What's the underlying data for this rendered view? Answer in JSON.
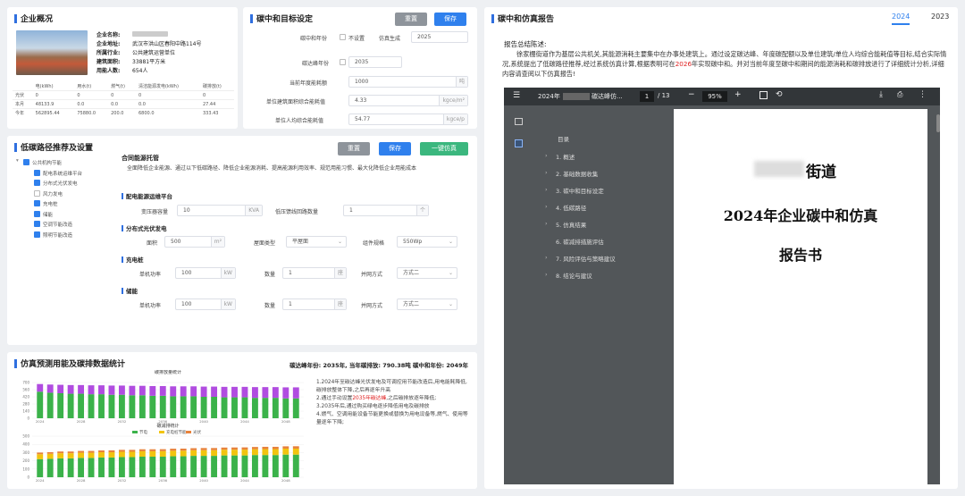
{
  "overview": {
    "title": "企业概况",
    "info": [
      {
        "label": "企业名称:",
        "value": ""
      },
      {
        "label": "企业地址:",
        "value": "武汉市洪山区春阳中路114号"
      },
      {
        "label": "所属行业:",
        "value": "公共建筑运营单位"
      },
      {
        "label": "建筑面积:",
        "value": "33881平方米"
      },
      {
        "label": "用能人数:",
        "value": "654人"
      }
    ],
    "table": {
      "headers": [
        "",
        "电(kWh)",
        "用水(t)",
        "燃气(t)",
        "清洁能源发电(kWh)",
        "碳排放(t)"
      ],
      "rows": [
        [
          "光伏",
          "0",
          "0",
          "0",
          "0",
          "0"
        ],
        [
          "本月",
          "48133.9",
          "0.0",
          "0.0",
          "0.0",
          "27.44"
        ],
        [
          "今年",
          "562895.44",
          "75880.0",
          "200.0",
          "6800.0",
          "333.43"
        ]
      ]
    }
  },
  "target": {
    "title": "碳中和目标设定",
    "reset": "重置",
    "save": "保存",
    "neutral_year_label": "碳中和年份",
    "not_set": "不设置",
    "simulate_label": "仿真生成",
    "neutral_year_value": "2025",
    "peak_year_label": "碳达峰年份",
    "peak_year_value": "2035",
    "total_label": "当前年度能耗额",
    "total_value": "1000",
    "total_unit": "吨",
    "area_label": "单位建筑面积综合能耗值",
    "area_value": "4.33",
    "area_unit": "kgce/m²",
    "person_label": "单位人均综合能耗值",
    "person_value": "54.77",
    "person_unit": "kgce/p"
  },
  "path": {
    "title": "低碳路径推荐及设置",
    "reset": "重置",
    "save": "保存",
    "simulate": "一键仿真",
    "tree": [
      "公共机构节能",
      "配电系统运维平台",
      "分布式光伏发电",
      "风力发电",
      "充电桩",
      "储能",
      "空调节能改造",
      "照明节能改造"
    ],
    "tree_checked": [
      true,
      true,
      true,
      false,
      true,
      true,
      true,
      true
    ],
    "intro_title": "合同能源托管",
    "intro_text": "全面降低企业能源、通过以下低碳路径、降低企业能源消耗、提高能源利用效率、规范用能习惯、最大化降低企业用能成本",
    "s1": "配电能源运维平台",
    "s1_cap_label": "变压器容量",
    "s1_cap_value": "10",
    "s1_cap_unit": "KVA",
    "s1_cnt_label": "低压馈线回路数量",
    "s1_cnt_value": "1",
    "s1_cnt_unit": "个",
    "s2": "分布式光伏发电",
    "s2_area_label": "面积",
    "s2_area_value": "500",
    "s2_area_unit": "m²",
    "s2_roof_label": "屋面类型",
    "s2_roof_value": "平屋面",
    "s2_spec_label": "组件规格",
    "s2_spec_value": "550Wp",
    "s3": "充电桩",
    "s3_power_label": "单机功率",
    "s3_power_value": "100",
    "s3_power_unit": "kW",
    "s3_cnt_label": "数量",
    "s3_cnt_value": "1",
    "s3_cnt_unit": "座",
    "s3_mode_label": "并网方式",
    "s3_mode_value": "方式二",
    "s4": "储能",
    "s4_power_label": "单机功率",
    "s4_power_value": "100",
    "s4_power_unit": "kW",
    "s4_cnt_label": "数量",
    "s4_cnt_value": "1",
    "s4_cnt_unit": "座",
    "s4_mode_label": "并网方式",
    "s4_mode_value": "方式二"
  },
  "sim": {
    "title": "仿真预测用能及碳排数据统计",
    "summary": "碳达峰年份: 2035年, 当年碳排放: 790.38吨  碳中和年份: 2049年",
    "chart1_title": "碳排放量统计",
    "chart2_title": "碳减排统计",
    "notes": [
      "1.2024年至碳达峰光伏发电及可调控用节能改造后,用电能耗降低,碳排放整体下降,之后再逐年升高",
      "2.通过手动设置2035年碳达峰,之后碳排放逐年降低;",
      "3.2035年后,通过购买绿电逐步降低用电及碳排放",
      "4.燃气、空调用能设备节能更换或替换为用电设备等,燃气、使用等量逐年下降;"
    ],
    "note_highlight": "2035年碳达峰"
  },
  "chart_data": [
    {
      "type": "bar",
      "title": "碳排放量统计",
      "categories": [
        "2024",
        "2025",
        "2026",
        "2027",
        "2028",
        "2029",
        "2030",
        "2031",
        "2032",
        "2033",
        "2034",
        "2035",
        "2036",
        "2037",
        "2038",
        "2039",
        "2040",
        "2041",
        "2042",
        "2043",
        "2044",
        "2045",
        "2046",
        "2047",
        "2048",
        "2049"
      ],
      "series": [
        {
          "name": "",
          "values": [
            520,
            500,
            490,
            480,
            480,
            470,
            470,
            460,
            460,
            450,
            450,
            440,
            440,
            430,
            430,
            430,
            420,
            420,
            410,
            410,
            410,
            400,
            400,
            400,
            390,
            390
          ],
          "color": "#3bb24a"
        },
        {
          "name": "",
          "values": [
            150,
            160,
            165,
            170,
            170,
            175,
            175,
            180,
            180,
            185,
            185,
            190,
            190,
            195,
            195,
            195,
            200,
            200,
            205,
            205,
            205,
            210,
            210,
            210,
            215,
            215
          ],
          "color": "#b04ce0"
        }
      ],
      "ylim": [
        0,
        700
      ]
    },
    {
      "type": "bar",
      "title": "碳减排统计",
      "legend": [
        "节电",
        "充电桩节能",
        "光伏"
      ],
      "categories": [
        "2024",
        "2025",
        "2026",
        "2027",
        "2028",
        "2029",
        "2030",
        "2031",
        "2032",
        "2033",
        "2034",
        "2035",
        "2036",
        "2037",
        "2038",
        "2039",
        "2040",
        "2041",
        "2042",
        "2043",
        "2044",
        "2045",
        "2046",
        "2047",
        "2048",
        "2049"
      ],
      "series": [
        {
          "name": "节电",
          "values": [
            220,
            225,
            230,
            230,
            235,
            235,
            240,
            240,
            245,
            245,
            250,
            250,
            250,
            255,
            255,
            260,
            260,
            260,
            265,
            265,
            265,
            270,
            270,
            270,
            275,
            275
          ],
          "color": "#3bb24a"
        },
        {
          "name": "充电桩节能",
          "values": [
            60,
            60,
            62,
            62,
            63,
            63,
            64,
            64,
            65,
            65,
            66,
            66,
            67,
            67,
            68,
            68,
            69,
            69,
            70,
            70,
            71,
            71,
            72,
            72,
            73,
            73
          ],
          "color": "#f2c40f"
        },
        {
          "name": "光伏",
          "values": [
            20,
            20,
            21,
            21,
            22,
            22,
            22,
            23,
            23,
            23,
            24,
            24,
            24,
            25,
            25,
            25,
            26,
            26,
            26,
            27,
            27,
            27,
            28,
            28,
            28,
            29
          ],
          "color": "#e8823a"
        }
      ],
      "ylim": [
        0,
        500
      ]
    }
  ],
  "report": {
    "title": "碳中和仿真报告",
    "tab_2024": "2024",
    "tab_2023": "2023",
    "summary_title": "报告总结陈述:",
    "summary_pre": "徐家棚街道作为基层公共机关,其能源消耗主要集中在办事处建筑上。通过设定碳达峰、年度碳配额以及单位建筑/单位人均综合能耗值等目标,结合实际情况,系统提出了低碳路径推荐,经过系统仿真计算,根据表明可在",
    "summary_red": "2026",
    "summary_post": "年实现碳中和。并对当前年度至碳中和期间的能源消耗和碳排放进行了详细统计分析,详细内容请查阅以下仿真报告!",
    "pdf": {
      "filename": "2024年",
      "filename_tail": "碳达峰仿...",
      "page": "1",
      "pages": "/ 13",
      "zoom": "95%",
      "toc_title": "目录",
      "toc": [
        "1. 概述",
        "2. 基础数据收集",
        "3. 碳中和目标设定",
        "4. 低碳路径",
        "5. 仿真结果",
        "6. 碳减排措施评估",
        "7. 风险评估与策略建议",
        "8. 结论与建议"
      ],
      "doc_line1": "街道",
      "doc_line2": "2024年企业碳中和仿真",
      "doc_line3": "报告书"
    }
  }
}
